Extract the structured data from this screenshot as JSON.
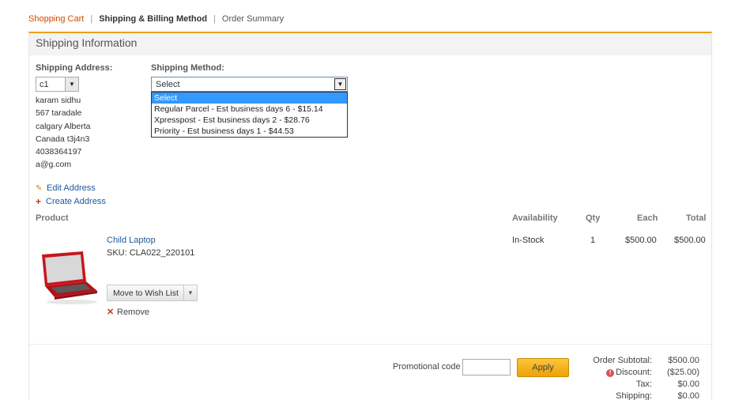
{
  "breadcrumb": {
    "cart": "Shopping Cart",
    "sep1": "|",
    "billing": "Shipping & Billing Method",
    "sep2": "|",
    "summary": "Order Summary"
  },
  "panel": {
    "title": "Shipping Information"
  },
  "shipping_address": {
    "label": "Shipping Address:",
    "selected": "c1",
    "lines": [
      "karam sidhu",
      "567 taradale",
      "calgary Alberta",
      "Canada t3j4n3",
      "4038364197",
      "a@g.com"
    ],
    "edit_link": "Edit Address",
    "create_link": "Create Address"
  },
  "shipping_method": {
    "label": "Shipping Method:",
    "selected": "Select",
    "options": [
      "Select",
      "Regular Parcel - Est business days 6 - $15.14",
      "Xpresspost - Est business days 2 - $28.76",
      "Priority - Est business days 1 - $44.53"
    ]
  },
  "table": {
    "headers": {
      "product": "Product",
      "availability": "Availability",
      "qty": "Qty",
      "each": "Each",
      "total": "Total"
    },
    "rows": [
      {
        "name": "Child Laptop",
        "sku": "SKU: CLA022_220101",
        "availability": "In-Stock",
        "qty": "1",
        "each": "$500.00",
        "total": "$500.00",
        "wish_button": "Move to Wish List",
        "remove": "Remove"
      }
    ]
  },
  "promo": {
    "label": "Promotional code",
    "value": "",
    "apply": "Apply"
  },
  "totals": {
    "subtotal_label": "Order Subtotal:",
    "subtotal": "$500.00",
    "discount_label": "Discount:",
    "discount": "($25.00)",
    "tax_label": "Tax:",
    "tax": "$0.00",
    "shipping_label": "Shipping:",
    "shipping": "$0.00"
  },
  "colors": {
    "accent": "#e8a317",
    "link": "#1a5a9c",
    "cart_crumb": "#cc4b00",
    "highlight": "#3399ff"
  }
}
